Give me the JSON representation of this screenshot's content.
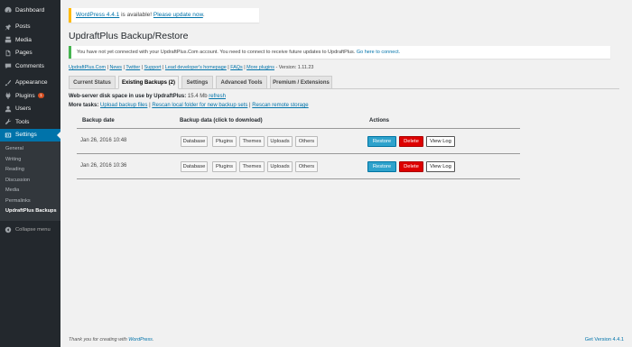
{
  "sidebar": {
    "items": [
      {
        "label": "Dashboard",
        "icon": "dashboard-icon"
      },
      {
        "label": "Posts",
        "icon": "pin-icon"
      },
      {
        "label": "Media",
        "icon": "media-icon"
      },
      {
        "label": "Pages",
        "icon": "pages-icon"
      },
      {
        "label": "Comments",
        "icon": "comments-icon"
      },
      {
        "label": "Appearance",
        "icon": "brush-icon"
      },
      {
        "label": "Plugins",
        "icon": "plugin-icon",
        "badge": "1"
      },
      {
        "label": "Users",
        "icon": "users-icon"
      },
      {
        "label": "Tools",
        "icon": "wrench-icon"
      },
      {
        "label": "Settings",
        "icon": "settings-icon"
      }
    ],
    "submenu": [
      "General",
      "Writing",
      "Reading",
      "Discussion",
      "Media",
      "Permalinks",
      "UpdraftPlus Backups"
    ],
    "collapse_label": "Collapse menu"
  },
  "update_notice": {
    "link1": "WordPress 4.4.1",
    "middle": " is available! ",
    "link2": "Please update now",
    "end": "."
  },
  "page_title": "UpdraftPlus Backup/Restore",
  "connect_notice": {
    "text": "You have not yet connected with your UpdraftPlus.Com account. You need to connect to receive future updates to UpdraftPlus. ",
    "link": "Go here to connect."
  },
  "links_line": {
    "links": [
      "UpdraftPlus.Com",
      "News",
      "Twitter",
      "Support",
      "Lead developer's homepage",
      "FAQs",
      "More plugins"
    ],
    "version": " - Version: 1.11.23"
  },
  "tabs": [
    "Current Status",
    "Existing Backups (2)",
    "Settings",
    "Advanced Tools",
    "Premium / Extensions"
  ],
  "disk": {
    "label": "Web-server disk space in use by UpdraftPlus:",
    "value": " 15.4 Mb ",
    "refresh": "refresh"
  },
  "tasks": {
    "label": "More tasks:",
    "upload": "Upload backup files",
    "rescan_local": "Rescan local folder for new backup sets",
    "rescan_remote": "Rescan remote storage"
  },
  "table": {
    "headers": {
      "date": "Backup date",
      "data": "Backup data (click to download)",
      "actions": "Actions"
    },
    "rows": [
      {
        "date": "Jan 26, 2016 10:48"
      },
      {
        "date": "Jan 26, 2016 10:36"
      }
    ],
    "data_buttons": [
      "Database",
      "Plugins",
      "Themes",
      "Uploads",
      "Others"
    ],
    "action_buttons": {
      "restore": "Restore",
      "delete": "Delete",
      "viewlog": "View Log"
    }
  },
  "footer": {
    "left_text": "Thank you for creating with ",
    "left_link": "WordPress",
    "left_end": ".",
    "right": "Get Version 4.4.1"
  }
}
